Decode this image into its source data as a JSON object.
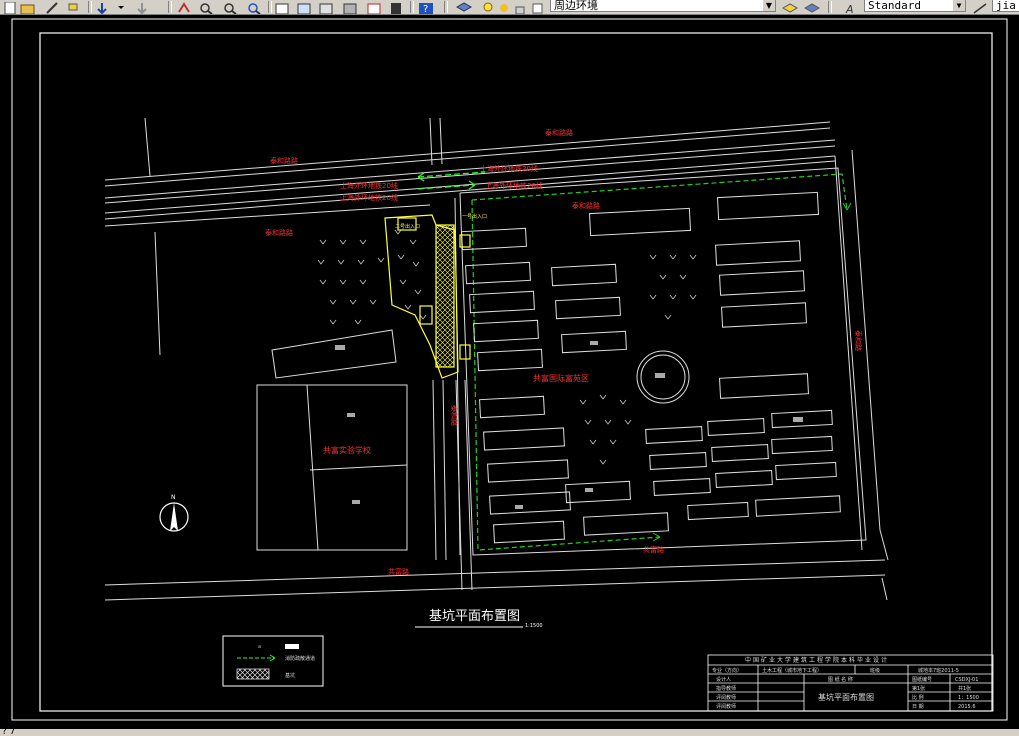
{
  "toolbar": {
    "layer_name": "周边环境",
    "text_style": "Standard",
    "right_text": "jia"
  },
  "drawing": {
    "title": "基坑平面布置图",
    "scale": "1:1500",
    "roads": {
      "north_top": "泰和路路",
      "north_left": "泰和路路",
      "north_mid": "泰和路路",
      "south_left": "泰和路路",
      "metro_upper": "上海外环地铁20线",
      "metro_lower": "上海外环地铁20线",
      "metro_right_upper": "上海外环地铁20线",
      "metro_right_lower": "上海外环地铁20线",
      "south_road": "共富路",
      "south_road_right": "共富路",
      "east_road": "泰和路",
      "west_road": "泰和路"
    },
    "areas": {
      "community": "共富国际富苑区",
      "school": "共富实验学校"
    },
    "entrances": {
      "entrance_1": "一号出入口",
      "entrance_2": "二号出入口"
    },
    "compass_label": "N"
  },
  "legend": {
    "items": [
      {
        "symbol": "a",
        "label": ""
      },
      {
        "symbol": "",
        "label": "消防疏散通道"
      },
      {
        "symbol": "",
        "label": "基坑"
      }
    ]
  },
  "title_block": {
    "header": "中国矿业大学建筑工程学院本科毕业设计",
    "major_label": "专业（方向）",
    "major_value": "土木工程（城市地下工程）",
    "grade_label": "班级",
    "grade_value": "城地本7班2011-5",
    "designer_label": "设计人",
    "drawing_name_label": "图 纸 名 称",
    "drawing_no_label": "图纸编号",
    "drawing_no_value": "CSDXJ-01",
    "advisor_label": "指导教师",
    "review_label": "评阅教师",
    "review2_label": "评阅教师",
    "sheet_title": "基坑平面布置图",
    "category_label": "第1张",
    "category_value": "共1张",
    "scale_label": "比 例",
    "scale_value": "1：1500",
    "date_label": "日 期",
    "date_value": "2015.6"
  },
  "status": {
    "text": "? 7"
  },
  "colors": {
    "background": "#000000",
    "lines": "#ffffff",
    "road_label": "#ff2020",
    "metro_arrow": "#20ff20",
    "evac_route": "#20e020",
    "pit": "#ffff40"
  }
}
